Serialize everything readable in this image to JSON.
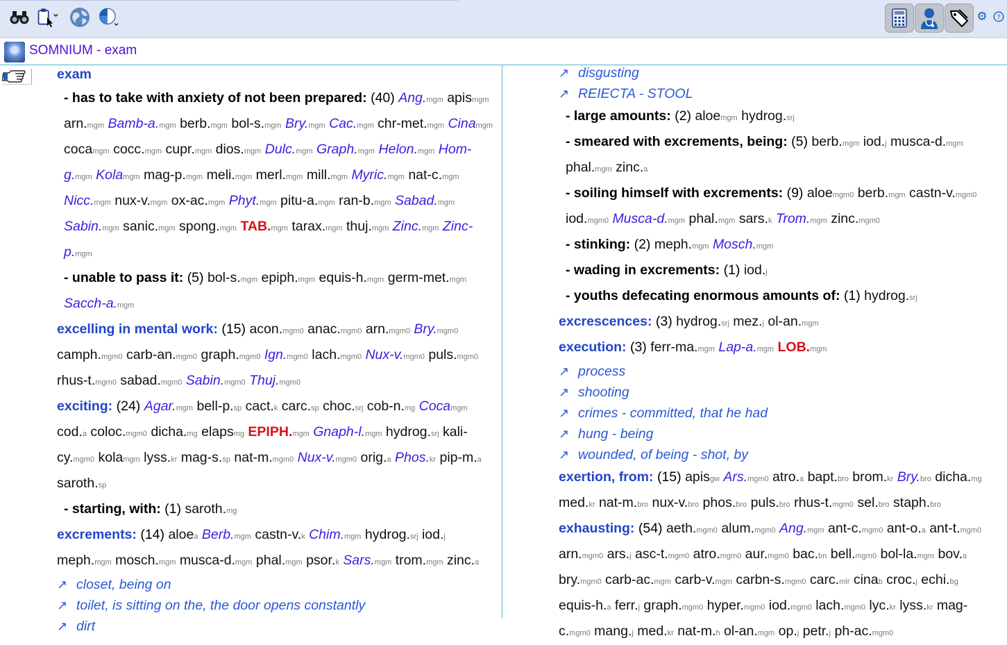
{
  "toolbar": {
    "left_icons": [
      "binoculars-icon",
      "clipboard-cursor-icon",
      "globe-icon",
      "pie-chart-icon"
    ],
    "right_icons": [
      "calculator-icon",
      "doctor-icon",
      "tags-icon",
      "gear-icon",
      "help-icon"
    ]
  },
  "window": {
    "title": "SOMNIUM - exam"
  },
  "left_column": [
    {
      "kind": "heading",
      "label": "exam"
    },
    {
      "kind": "sub",
      "label": "- has to take with anxiety of not been prepared:",
      "count": "(40)",
      "remedies": [
        {
          "n": "Ang.",
          "s": "mgm",
          "g": 2
        },
        {
          "n": "apis",
          "s": "mgm",
          "g": 1
        },
        {
          "n": "arn.",
          "s": "mgm",
          "g": 1
        },
        {
          "n": "Bamb-a.",
          "s": "mgm",
          "g": 2
        },
        {
          "n": "berb.",
          "s": "mgm",
          "g": 1
        },
        {
          "n": "bol-s.",
          "s": "mgm",
          "g": 1
        },
        {
          "n": "Bry.",
          "s": "mgm",
          "g": 2
        },
        {
          "n": "Cac.",
          "s": "mgm",
          "g": 2
        },
        {
          "n": "chr-met.",
          "s": "mgm",
          "g": 1
        },
        {
          "n": "Cina",
          "s": "mgm",
          "g": 2
        },
        {
          "n": "coca",
          "s": "mgm",
          "g": 1
        },
        {
          "n": "cocc.",
          "s": "mgm",
          "g": 1
        },
        {
          "n": "cupr.",
          "s": "mgm",
          "g": 1
        },
        {
          "n": "dios.",
          "s": "mgm",
          "g": 1
        },
        {
          "n": "Dulc.",
          "s": "mgm",
          "g": 2
        },
        {
          "n": "Graph.",
          "s": "mgm",
          "g": 2
        },
        {
          "n": "Helon.",
          "s": "mgm",
          "g": 2
        },
        {
          "n": "Hom-g.",
          "s": "mgm",
          "g": 2
        },
        {
          "n": "Kola",
          "s": "mgm",
          "g": 2
        },
        {
          "n": "mag-p.",
          "s": "mgm",
          "g": 1
        },
        {
          "n": "meli.",
          "s": "mgm",
          "g": 1
        },
        {
          "n": "merl.",
          "s": "mgm",
          "g": 1
        },
        {
          "n": "mill.",
          "s": "mgm",
          "g": 1
        },
        {
          "n": "Myric.",
          "s": "mgm",
          "g": 2
        },
        {
          "n": "nat-c.",
          "s": "mgm",
          "g": 1
        },
        {
          "n": "Nicc.",
          "s": "mgm",
          "g": 2
        },
        {
          "n": "nux-v.",
          "s": "mgm",
          "g": 1
        },
        {
          "n": "ox-ac.",
          "s": "mgm",
          "g": 1
        },
        {
          "n": "Phyt.",
          "s": "mgm",
          "g": 2
        },
        {
          "n": "pitu-a.",
          "s": "mgm",
          "g": 1
        },
        {
          "n": "ran-b.",
          "s": "mgm",
          "g": 1
        },
        {
          "n": "Sabad.",
          "s": "mgm",
          "g": 2
        },
        {
          "n": "Sabin.",
          "s": "mgm",
          "g": 2
        },
        {
          "n": "sanic.",
          "s": "mgm",
          "g": 1
        },
        {
          "n": "spong.",
          "s": "mgm",
          "g": 1
        },
        {
          "n": "TAB.",
          "s": "mgm",
          "g": 3
        },
        {
          "n": "tarax.",
          "s": "mgm",
          "g": 1
        },
        {
          "n": "thuj.",
          "s": "mgm",
          "g": 1
        },
        {
          "n": "Zinc.",
          "s": "mgm",
          "g": 2
        },
        {
          "n": "Zinc-p.",
          "s": "mgm",
          "g": 2
        }
      ]
    },
    {
      "kind": "sub",
      "label": "- unable to pass it:",
      "count": "(5)",
      "remedies": [
        {
          "n": "bol-s.",
          "s": "mgm",
          "g": 1
        },
        {
          "n": "epiph.",
          "s": "mgm",
          "g": 1
        },
        {
          "n": "equis-h.",
          "s": "mgm",
          "g": 1
        },
        {
          "n": "germ-met.",
          "s": "mgm",
          "g": 1
        },
        {
          "n": "Sacch-a.",
          "s": "mgm",
          "g": 2
        }
      ]
    },
    {
      "kind": "heading",
      "label": "excelling in mental work:",
      "count": "(15)",
      "remedies": [
        {
          "n": "acon.",
          "s": "mgm0",
          "g": 1
        },
        {
          "n": "anac.",
          "s": "mgm0",
          "g": 1
        },
        {
          "n": "arn.",
          "s": "mgm0",
          "g": 1
        },
        {
          "n": "Bry.",
          "s": "mgm0",
          "g": 2
        },
        {
          "n": "camph.",
          "s": "mgm0",
          "g": 1
        },
        {
          "n": "carb-an.",
          "s": "mgm0",
          "g": 1
        },
        {
          "n": "graph.",
          "s": "mgm0",
          "g": 1
        },
        {
          "n": "Ign.",
          "s": "mgm0",
          "g": 2
        },
        {
          "n": "lach.",
          "s": "mgm0",
          "g": 1
        },
        {
          "n": "Nux-v.",
          "s": "mgm0",
          "g": 2
        },
        {
          "n": "puls.",
          "s": "mgm0",
          "g": 1
        },
        {
          "n": "rhus-t.",
          "s": "mgm0",
          "g": 1
        },
        {
          "n": "sabad.",
          "s": "mgm0",
          "g": 1
        },
        {
          "n": "Sabin.",
          "s": "mgm0",
          "g": 2
        },
        {
          "n": "Thuj.",
          "s": "mgm0",
          "g": 2
        }
      ]
    },
    {
      "kind": "heading",
      "label": "exciting:",
      "count": "(24)",
      "remedies": [
        {
          "n": "Agar.",
          "s": "mgm",
          "g": 2
        },
        {
          "n": "bell-p.",
          "s": "sp",
          "g": 1
        },
        {
          "n": "cact.",
          "s": "k",
          "g": 1
        },
        {
          "n": "carc.",
          "s": "sp",
          "g": 1
        },
        {
          "n": "choc.",
          "s": "srj",
          "g": 1
        },
        {
          "n": "cob-n.",
          "s": "mg",
          "g": 1
        },
        {
          "n": "Coca",
          "s": "mgm",
          "g": 2
        },
        {
          "n": "cod.",
          "s": "a",
          "g": 1
        },
        {
          "n": "coloc.",
          "s": "mgm0",
          "g": 1
        },
        {
          "n": "dicha.",
          "s": "mg",
          "g": 1
        },
        {
          "n": "elaps",
          "s": "mg",
          "g": 1
        },
        {
          "n": "EPIPH.",
          "s": "mgm",
          "g": 3
        },
        {
          "n": "Gnaph-l.",
          "s": "mgm",
          "g": 2
        },
        {
          "n": "hydrog.",
          "s": "srj",
          "g": 1
        },
        {
          "n": "kali-cy.",
          "s": "mgm0",
          "g": 1
        },
        {
          "n": "kola",
          "s": "mgm",
          "g": 1
        },
        {
          "n": "lyss.",
          "s": "kr",
          "g": 1
        },
        {
          "n": "mag-s.",
          "s": "sp",
          "g": 1
        },
        {
          "n": "nat-m.",
          "s": "mgm0",
          "g": 1
        },
        {
          "n": "Nux-v.",
          "s": "mgm0",
          "g": 2
        },
        {
          "n": "orig.",
          "s": "a",
          "g": 1
        },
        {
          "n": "Phos.",
          "s": "kr",
          "g": 2
        },
        {
          "n": "pip-m.",
          "s": "a",
          "g": 1
        },
        {
          "n": "saroth.",
          "s": "sp",
          "g": 1
        }
      ]
    },
    {
      "kind": "sub",
      "label": "- starting, with:",
      "count": "(1)",
      "remedies": [
        {
          "n": "saroth.",
          "s": "mg",
          "g": 1
        }
      ]
    },
    {
      "kind": "heading",
      "label": "excrements:",
      "count": "(14)",
      "remedies": [
        {
          "n": "aloe",
          "s": "a",
          "g": 1
        },
        {
          "n": "Berb.",
          "s": "mgm",
          "g": 2
        },
        {
          "n": "castn-v.",
          "s": "k",
          "g": 1
        },
        {
          "n": "Chim.",
          "s": "mgm",
          "g": 2
        },
        {
          "n": "hydrog.",
          "s": "srj",
          "g": 1
        },
        {
          "n": "iod.",
          "s": "j",
          "g": 1
        },
        {
          "n": "meph.",
          "s": "mgm",
          "g": 1
        },
        {
          "n": "mosch.",
          "s": "mgm",
          "g": 1
        },
        {
          "n": "musca-d.",
          "s": "mgm",
          "g": 1
        },
        {
          "n": "phal.",
          "s": "mgm",
          "g": 1
        },
        {
          "n": "psor.",
          "s": "k",
          "g": 1
        },
        {
          "n": "Sars.",
          "s": "mgm",
          "g": 2
        },
        {
          "n": "trom.",
          "s": "mgm",
          "g": 1
        },
        {
          "n": "zinc.",
          "s": "a",
          "g": 1
        }
      ]
    },
    {
      "kind": "xref",
      "label": "closet, being on"
    },
    {
      "kind": "xref",
      "label": "toilet, is sitting on the, the door opens constantly"
    },
    {
      "kind": "xref",
      "label": "dirt"
    }
  ],
  "right_column": [
    {
      "kind": "xref",
      "label": "disgusting"
    },
    {
      "kind": "xref",
      "label": "REIECTA - STOOL"
    },
    {
      "kind": "sub",
      "label": "- large amounts:",
      "count": "(2)",
      "remedies": [
        {
          "n": "aloe",
          "s": "mgm",
          "g": 1
        },
        {
          "n": "hydrog.",
          "s": "srj",
          "g": 1
        }
      ]
    },
    {
      "kind": "sub",
      "label": "- smeared with excrements, being:",
      "count": "(5)",
      "remedies": [
        {
          "n": "berb.",
          "s": "mgm",
          "g": 1
        },
        {
          "n": "iod.",
          "s": "j",
          "g": 1
        },
        {
          "n": "musca-d.",
          "s": "mgm",
          "g": 1
        },
        {
          "n": "phal.",
          "s": "mgm",
          "g": 1
        },
        {
          "n": "zinc.",
          "s": "a",
          "g": 1
        }
      ]
    },
    {
      "kind": "sub",
      "label": "- soiling himself with excrements:",
      "count": "(9)",
      "remedies": [
        {
          "n": "aloe",
          "s": "mgm0",
          "g": 1
        },
        {
          "n": "berb.",
          "s": "mgm",
          "g": 1
        },
        {
          "n": "castn-v.",
          "s": "mgm0",
          "g": 1
        },
        {
          "n": "iod.",
          "s": "mgm0",
          "g": 1
        },
        {
          "n": "Musca-d.",
          "s": "mgm",
          "g": 2
        },
        {
          "n": "phal.",
          "s": "mgm",
          "g": 1
        },
        {
          "n": "sars.",
          "s": "k",
          "g": 1
        },
        {
          "n": "Trom.",
          "s": "mgm",
          "g": 2
        },
        {
          "n": "zinc.",
          "s": "mgm0",
          "g": 1
        }
      ]
    },
    {
      "kind": "sub",
      "label": "- stinking:",
      "count": "(2)",
      "remedies": [
        {
          "n": "meph.",
          "s": "mgm",
          "g": 1
        },
        {
          "n": "Mosch.",
          "s": "mgm",
          "g": 2
        }
      ]
    },
    {
      "kind": "sub",
      "label": "- wading in excrements:",
      "count": "(1)",
      "remedies": [
        {
          "n": "iod.",
          "s": "j",
          "g": 1
        }
      ]
    },
    {
      "kind": "sub",
      "label": "- youths defecating enormous amounts of:",
      "count": "(1)",
      "remedies": [
        {
          "n": "hydrog.",
          "s": "srj",
          "g": 1
        }
      ]
    },
    {
      "kind": "heading",
      "label": "excrescences:",
      "count": "(3)",
      "remedies": [
        {
          "n": "hydrog.",
          "s": "srj",
          "g": 1
        },
        {
          "n": "mez.",
          "s": "j",
          "g": 1
        },
        {
          "n": "ol-an.",
          "s": "mgm",
          "g": 1
        }
      ]
    },
    {
      "kind": "heading",
      "label": "execution:",
      "count": "(3)",
      "remedies": [
        {
          "n": "ferr-ma.",
          "s": "mgm",
          "g": 1
        },
        {
          "n": "Lap-a.",
          "s": "mgm",
          "g": 2
        },
        {
          "n": "LOB.",
          "s": "mgm",
          "g": 3
        }
      ]
    },
    {
      "kind": "xref",
      "label": "process"
    },
    {
      "kind": "xref",
      "label": "shooting"
    },
    {
      "kind": "xref",
      "label": "crimes - committed, that he had"
    },
    {
      "kind": "xref",
      "label": "hung - being"
    },
    {
      "kind": "xref",
      "label": "wounded, of being - shot, by"
    },
    {
      "kind": "heading",
      "label": "exertion, from:",
      "count": "(15)",
      "remedies": [
        {
          "n": "apis",
          "s": "gw",
          "g": 1
        },
        {
          "n": "Ars.",
          "s": "mgm0",
          "g": 2
        },
        {
          "n": "atro.",
          "s": "a",
          "g": 1
        },
        {
          "n": "bapt.",
          "s": "bro",
          "g": 1
        },
        {
          "n": "brom.",
          "s": "kr",
          "g": 1
        },
        {
          "n": "Bry.",
          "s": "bro",
          "g": 2
        },
        {
          "n": "dicha.",
          "s": "mg",
          "g": 1
        },
        {
          "n": "med.",
          "s": "kr",
          "g": 1
        },
        {
          "n": "nat-m.",
          "s": "bro",
          "g": 1
        },
        {
          "n": "nux-v.",
          "s": "bro",
          "g": 1
        },
        {
          "n": "phos.",
          "s": "bro",
          "g": 1
        },
        {
          "n": "puls.",
          "s": "bro",
          "g": 1
        },
        {
          "n": "rhus-t.",
          "s": "mgm0",
          "g": 1
        },
        {
          "n": "sel.",
          "s": "bro",
          "g": 1
        },
        {
          "n": "staph.",
          "s": "bro",
          "g": 1
        }
      ]
    },
    {
      "kind": "heading",
      "label": "exhausting:",
      "count": "(54)",
      "remedies": [
        {
          "n": "aeth.",
          "s": "mgm0",
          "g": 1
        },
        {
          "n": "alum.",
          "s": "mgm0",
          "g": 1
        },
        {
          "n": "Ang.",
          "s": "mgm",
          "g": 2
        },
        {
          "n": "ant-c.",
          "s": "mgm0",
          "g": 1
        },
        {
          "n": "ant-o.",
          "s": "a",
          "g": 1
        },
        {
          "n": "ant-t.",
          "s": "mgm0",
          "g": 1
        },
        {
          "n": "arn.",
          "s": "mgm0",
          "g": 1
        },
        {
          "n": "ars.",
          "s": "j",
          "g": 1
        },
        {
          "n": "asc-t.",
          "s": "mgm0",
          "g": 1
        },
        {
          "n": "atro.",
          "s": "mgm0",
          "g": 1
        },
        {
          "n": "aur.",
          "s": "mgm0",
          "g": 1
        },
        {
          "n": "bac.",
          "s": "bn",
          "g": 1
        },
        {
          "n": "bell.",
          "s": "mgm0",
          "g": 1
        },
        {
          "n": "bol-la.",
          "s": "mgm",
          "g": 1
        },
        {
          "n": "bov.",
          "s": "a",
          "g": 1
        },
        {
          "n": "bry.",
          "s": "mgm0",
          "g": 1
        },
        {
          "n": "carb-ac.",
          "s": "mgm",
          "g": 1
        },
        {
          "n": "carb-v.",
          "s": "mgm",
          "g": 1
        },
        {
          "n": "carbn-s.",
          "s": "mgm0",
          "g": 1
        },
        {
          "n": "carc.",
          "s": "mlr",
          "g": 1
        },
        {
          "n": "cina",
          "s": "b",
          "g": 1
        },
        {
          "n": "croc.",
          "s": "j",
          "g": 1
        },
        {
          "n": "echi.",
          "s": "bg",
          "g": 1
        },
        {
          "n": "equis-h.",
          "s": "a",
          "g": 1
        },
        {
          "n": "ferr.",
          "s": "j",
          "g": 1
        },
        {
          "n": "graph.",
          "s": "mgm0",
          "g": 1
        },
        {
          "n": "hyper.",
          "s": "mgm0",
          "g": 1
        },
        {
          "n": "iod.",
          "s": "mgm0",
          "g": 1
        },
        {
          "n": "lach.",
          "s": "mgm0",
          "g": 1
        },
        {
          "n": "lyc.",
          "s": "kr",
          "g": 1
        },
        {
          "n": "lyss.",
          "s": "kr",
          "g": 1
        },
        {
          "n": "mag-c.",
          "s": "mgm0",
          "g": 1
        },
        {
          "n": "mang.",
          "s": "j",
          "g": 1
        },
        {
          "n": "med.",
          "s": "kr",
          "g": 1
        },
        {
          "n": "nat-m.",
          "s": "h",
          "g": 1
        },
        {
          "n": "ol-an.",
          "s": "mgm",
          "g": 1
        },
        {
          "n": "op.",
          "s": "j",
          "g": 1
        },
        {
          "n": "petr.",
          "s": "j",
          "g": 1
        },
        {
          "n": "ph-ac.",
          "s": "mgm0",
          "g": 1
        }
      ]
    }
  ],
  "colors": {
    "heading": "#2046c8",
    "grade2": "#3a1ee0",
    "grade3": "#d8101c",
    "title": "#4b10d8",
    "toolbar_bg": "#dfe6f5",
    "divider": "#4fb7c9"
  }
}
